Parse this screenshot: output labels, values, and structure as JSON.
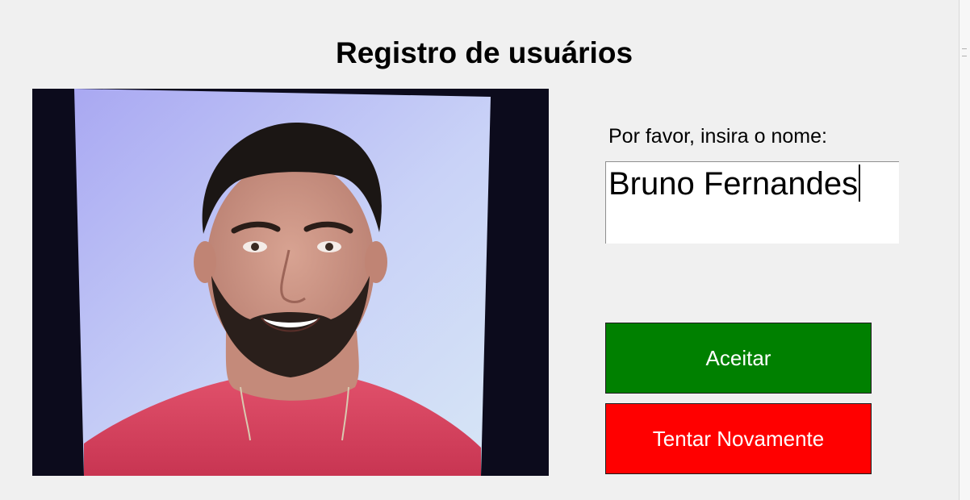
{
  "window": {
    "title": "Registro de usuários"
  },
  "form": {
    "prompt": "Por favor, insira o nome:",
    "name_value": "Bruno Fernandes"
  },
  "buttons": {
    "accept_label": "Aceitar",
    "retry_label": "Tentar Novamente"
  },
  "colors": {
    "background": "#f0f0f0",
    "accept": "#008000",
    "retry": "#ff0000",
    "button_text": "#ffffff"
  }
}
